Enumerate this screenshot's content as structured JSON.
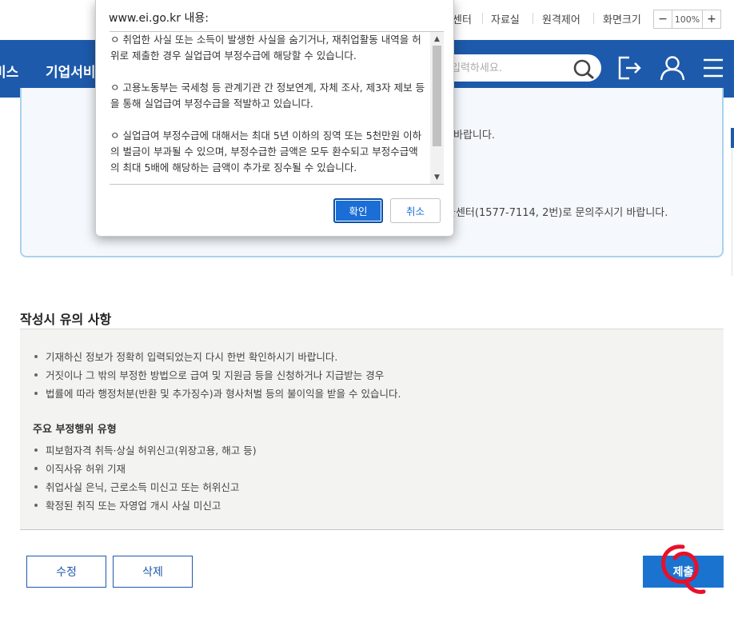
{
  "utility": {
    "callcenter_partial": "센터",
    "archive": "자료실",
    "remote": "원격제어",
    "screen_size": "화면크기",
    "zoom_minus": "−",
    "zoom_value": "100%",
    "zoom_plus": "+"
  },
  "nav": {
    "item_1_partial": "비스",
    "item_2_partial": "기업서비",
    "search_placeholder": "입력하세요."
  },
  "info_box": {
    "line_1_partial": "바랍니다.",
    "line_2_partial": "콜센터(1577-7114, 2번)로 문의주시기 바랍니다."
  },
  "notice": {
    "title": "작성시 유의 사항",
    "bullets": [
      "기재하신 정보가 정확히 입력되었는지 다시 한번 확인하시기 바랍니다.",
      "거짓이나 그 밖의 부정한 방법으로 급여 및 지원금 등을 신청하거나 지급받는 경우",
      "법률에 따라 행정처분(반환 및 추가징수)과 형사처벌 등의 불이익을 받을 수 있습니다."
    ],
    "subhead": "주요 부정행위 유형",
    "types": [
      "피보험자격 취득·상실 허위신고(위장고용, 해고 등)",
      "이직사유 허위 기재",
      "취업사실 은닉, 근로소득 미신고 또는 허위신고",
      "확정된 취직 또는 자영업 개시 사실 미신고"
    ]
  },
  "buttons": {
    "edit": "수정",
    "delete": "삭제",
    "submit": "제출"
  },
  "dialog": {
    "title": "www.ei.go.kr 내용:",
    "paragraphs": [
      "ㅇ 취업한 사실 또는 소득이 발생한 사실을 숨기거나, 재취업활동 내역을 허위로 제출한 경우 실업급여 부정수급에 해당할 수 있습니다.",
      "ㅇ 고용노동부는 국세청 등 관계기관 간 정보연계, 자체 조사, 제3자 제보 등을 통해 실업급여 부정수급을 적발하고 있습니다.",
      "ㅇ 실업급여 부정수급에 대해서는 최대 5년 이하의 징역 또는 5천만원 이하의 벌금이 부과될 수 있으며, 부정수급한 금액은 모두 환수되고 부정수급액의 최대 5배에 해당하는 금액이 추가로 징수될 수 있습니다."
    ],
    "ok": "확인",
    "cancel": "취소"
  },
  "colors": {
    "nav_blue": "#1d5aab",
    "submit_blue": "#1a74cf",
    "annotation_red": "#e8102a"
  }
}
